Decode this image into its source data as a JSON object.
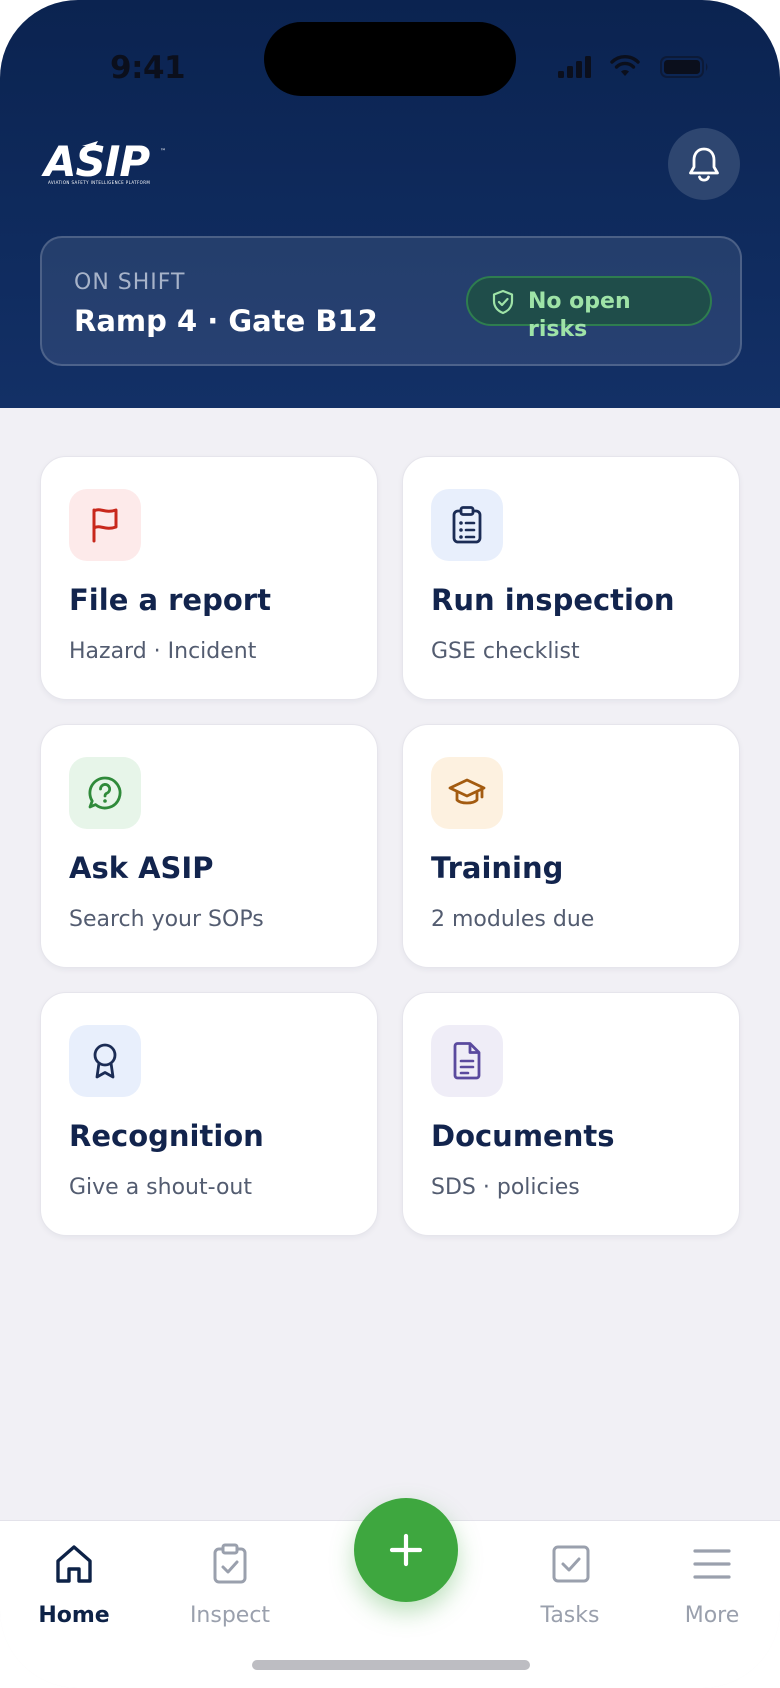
{
  "status_bar": {
    "time": "9:41"
  },
  "header": {
    "logo_text": "ASIP",
    "logo_tagline": "AVIATION SAFETY INTELLIGENCE PLATFORM",
    "logo_tm": "™",
    "notification_icon": "bell-icon"
  },
  "shift": {
    "label": "ON SHIFT",
    "location": "Ramp 4 · Gate B12",
    "risk_status": "No open risks"
  },
  "tiles": [
    {
      "title": "File a report",
      "subtitle": "Hazard · Incident",
      "icon": "flag-icon",
      "icon_color": "#c8281c",
      "icon_bg": "#fdeaea"
    },
    {
      "title": "Run inspection",
      "subtitle": "GSE checklist",
      "icon": "clipboard-list-icon",
      "icon_color": "#1b2c55",
      "icon_bg": "#e8effc"
    },
    {
      "title": "Ask ASIP",
      "subtitle": "Search your SOPs",
      "icon": "help-chat-icon",
      "icon_color": "#2f8a3a",
      "icon_bg": "#e7f5e9"
    },
    {
      "title": "Training",
      "subtitle": "2 modules due",
      "icon": "graduation-cap-icon",
      "icon_color": "#a35b10",
      "icon_bg": "#fdf1e0"
    },
    {
      "title": "Recognition",
      "subtitle": "Give a shout-out",
      "icon": "award-icon",
      "icon_color": "#1b2c55",
      "icon_bg": "#e8effc"
    },
    {
      "title": "Documents",
      "subtitle": "SDS · policies",
      "icon": "document-icon",
      "icon_color": "#5a4a9e",
      "icon_bg": "#efedf7"
    }
  ],
  "nav": {
    "items": [
      {
        "label": "Home",
        "icon": "home-icon",
        "active": true
      },
      {
        "label": "Inspect",
        "icon": "clipboard-check-icon",
        "active": false
      },
      {
        "label": "Tasks",
        "icon": "checkbox-icon",
        "active": false
      },
      {
        "label": "More",
        "icon": "menu-icon",
        "active": false
      }
    ],
    "fab_icon": "plus-icon"
  },
  "colors": {
    "header_bg": "#0f2b5e",
    "accent_green": "#3ea73f",
    "navy_text": "#12244d",
    "page_bg": "#f1f0f5"
  }
}
